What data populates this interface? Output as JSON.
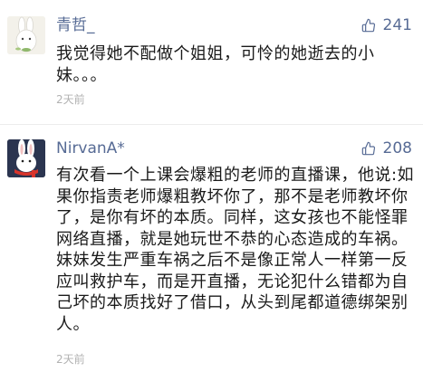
{
  "comments": [
    {
      "username": "青哲_",
      "likes": "241",
      "body": "我觉得她不配做个姐姐，可怜的她逝去的小妹。。。",
      "time": "2天前",
      "avatar_icon": "bunny-avatar-icon"
    },
    {
      "username": "NirvanA*",
      "likes": "208",
      "body": "有次看一个上课会爆粗的老师的直播课，他说:如果你指责老师爆粗教坏你了，那不是老师教坏你了，是你有坏的本质。同样，这女孩也不能怪罪网络直播，就是她玩世不恭的心态造成的车祸。妹妹发生严重车祸之后不是像正常人一样第一反应叫救护车，而是开直播，无论犯什么错都为自己坏的本质找好了借口，从头到尾都道德绑架别人。",
      "time": "2天前",
      "avatar_icon": "rabbit-scarf-avatar-icon"
    }
  ],
  "colors": {
    "name": "#576b95",
    "text": "#1a1a1a",
    "time": "#b2b2b2"
  }
}
